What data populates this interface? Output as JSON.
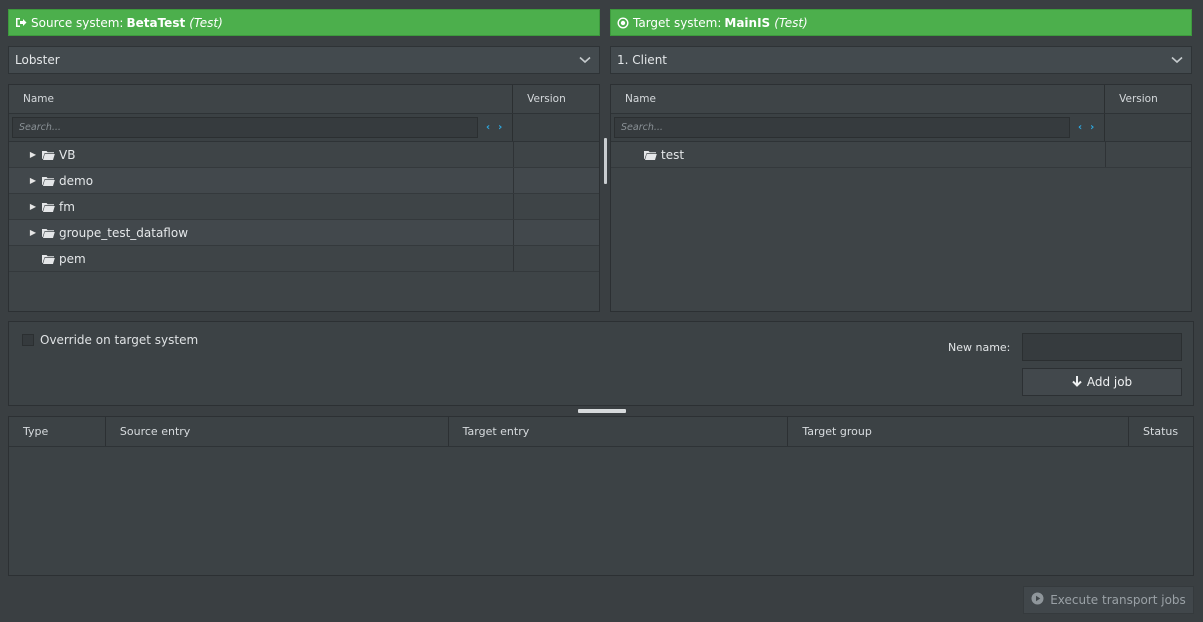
{
  "source_system": {
    "prefix": "Source system:",
    "name": "BetaTest",
    "env": "(Test)",
    "icon": "sign-out-icon"
  },
  "target_system": {
    "prefix": "Target system:",
    "name": "MainIS",
    "env": "(Test)",
    "icon": "dot-circle-icon"
  },
  "source_dropdown": {
    "value": "Lobster"
  },
  "target_dropdown": {
    "value": "1. Client"
  },
  "source_tree": {
    "columns": {
      "name": "Name",
      "version": "Version"
    },
    "search_placeholder": "Search...",
    "rows": [
      {
        "label": "VB",
        "expandable": true
      },
      {
        "label": "demo",
        "expandable": true
      },
      {
        "label": "fm",
        "expandable": true
      },
      {
        "label": "groupe_test_dataflow",
        "expandable": true
      },
      {
        "label": "pem",
        "expandable": false
      }
    ]
  },
  "target_tree": {
    "columns": {
      "name": "Name",
      "version": "Version"
    },
    "search_placeholder": "Search...",
    "rows": [
      {
        "label": "test",
        "expandable": false
      }
    ]
  },
  "options": {
    "override_label": "Override on target system",
    "override_checked": false,
    "new_name_label": "New name:",
    "new_name_value": "",
    "add_job_label": "Add job"
  },
  "jobs_table": {
    "columns": [
      "Type",
      "Source entry",
      "Target entry",
      "Target group",
      "Status"
    ],
    "rows": []
  },
  "execute_label": "Execute transport jobs",
  "colors": {
    "header_green": "#4caf4c",
    "accent_blue": "#2ea8e0",
    "background": "#3a3f42"
  }
}
